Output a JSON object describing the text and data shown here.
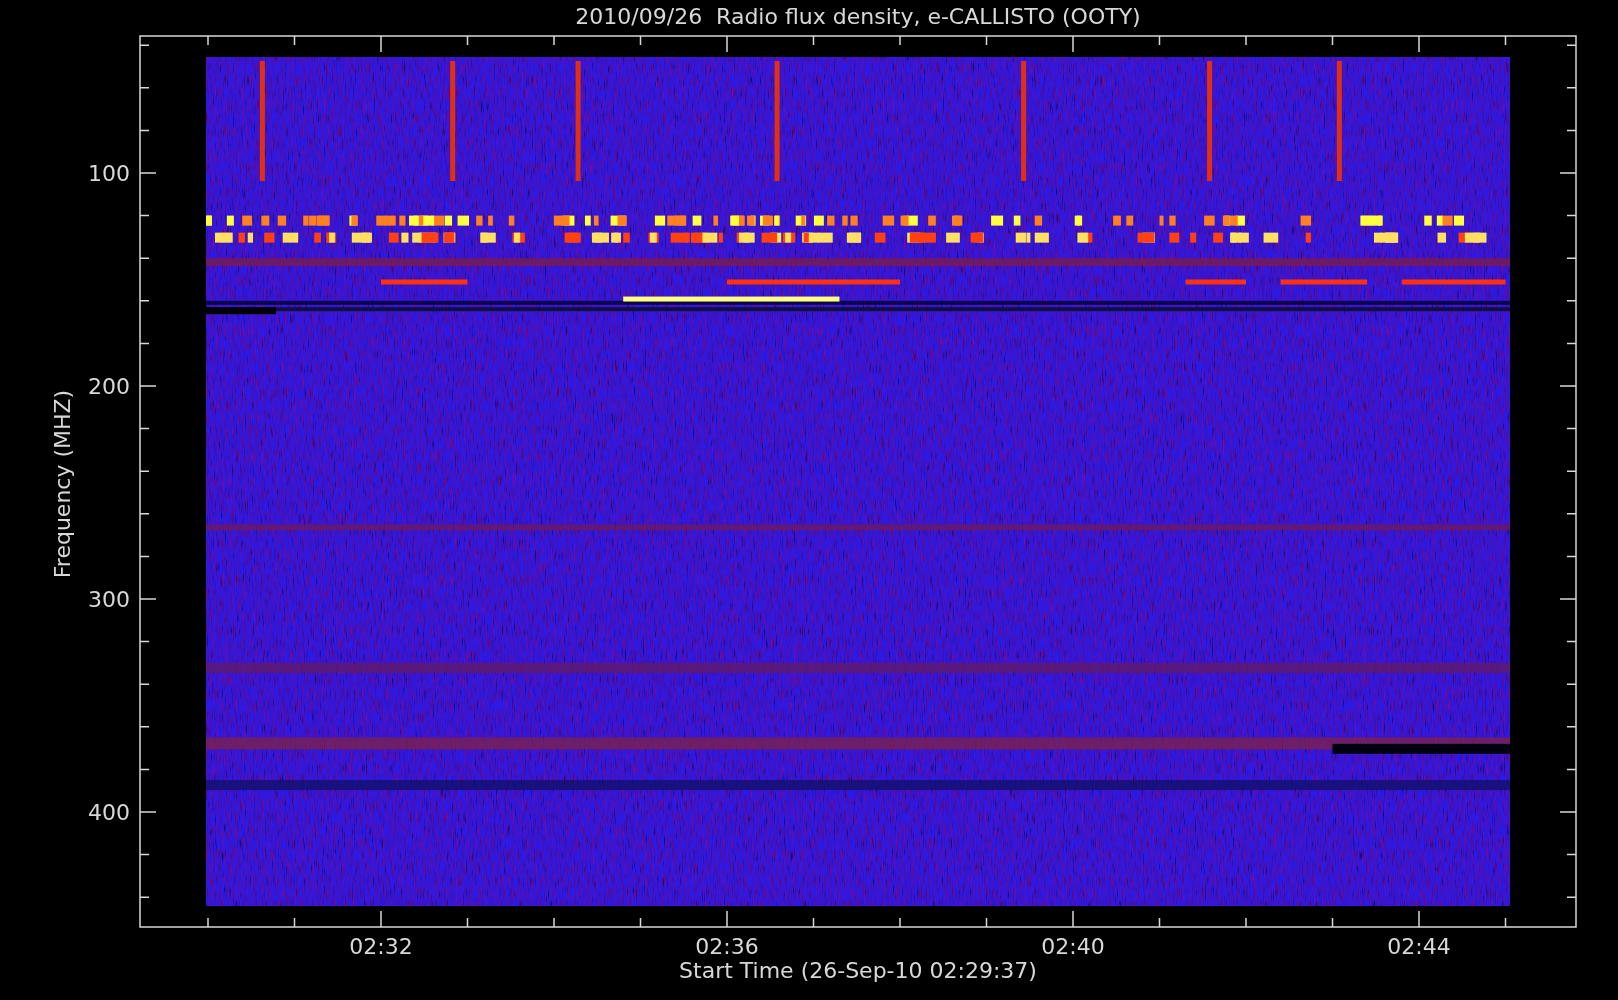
{
  "plot": {
    "title": "2010/09/26  Radio flux density, e-CALLISTO (OOTY)",
    "ylabel": "Frequency (MHZ)",
    "xlabel": "Start Time (26-Sep-10 02:29:37)",
    "y_tick_labels": [
      "100",
      "200",
      "300",
      "400"
    ],
    "x_tick_labels": [
      "02:32",
      "02:36",
      "02:40",
      "02:44"
    ]
  }
}
